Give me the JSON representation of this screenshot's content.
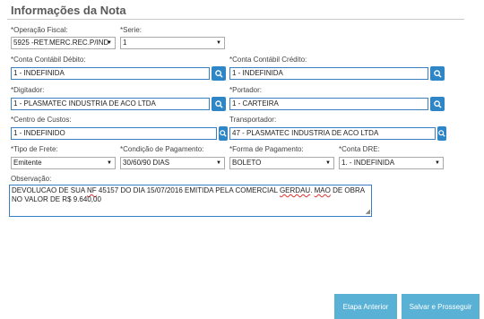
{
  "title": "Informações da Nota",
  "fields": {
    "operacao": {
      "label": "*Operação Fiscal:",
      "value": "5925 -RET.MERC.REC.P/IND"
    },
    "serie": {
      "label": "*Serie:",
      "value": "1"
    },
    "conta_debito": {
      "label": "*Conta Contábil Débito:",
      "value": "1 - INDEFINIDA"
    },
    "conta_credito": {
      "label": "*Conta Contábil Crédito:",
      "value": "1 - INDEFINIDA"
    },
    "digitador": {
      "label": "*Digitador:",
      "value": "1 - PLASMATEC INDUSTRIA DE ACO LTDA"
    },
    "portador": {
      "label": "*Portador:",
      "value": "1 - CARTEIRA"
    },
    "centro_custos": {
      "label": "*Centro de Custos:",
      "value": "1 - INDEFINIDO"
    },
    "transportador": {
      "label": "Transportador:",
      "value": "47 - PLASMATEC INDUSTRIA DE ACO LTDA"
    },
    "tipo_frete": {
      "label": "*Tipo de Frete:",
      "value": "Emitente"
    },
    "condicao_pagamento": {
      "label": "*Condição de Pagamento:",
      "value": "30/60/90 DIAS"
    },
    "forma_pagamento": {
      "label": "*Forma de Pagamento:",
      "value": "BOLETO"
    },
    "conta_dre": {
      "label": "*Conta DRE:",
      "value": "1. - INDEFINIDA"
    },
    "observacao": {
      "label": "Observação:",
      "segments": [
        "DEVOLUCAO DE SUA ",
        "NF",
        " 45157 DO DIA 15/07/2016 EMITIDA PELA COMERCIAL ",
        "GERDAU",
        ". ",
        "MAO",
        " DE OBRA NO VALOR DE R$ 9.640,00"
      ]
    }
  },
  "buttons": {
    "previous": "Etapa Anterior",
    "save_next": "Salvar e Prosseguir"
  },
  "icons": {
    "search": "magnifier-icon",
    "dropdown": "chevron-down-icon"
  },
  "colors": {
    "accent": "#2f86c6",
    "button": "#5ab1d6"
  }
}
